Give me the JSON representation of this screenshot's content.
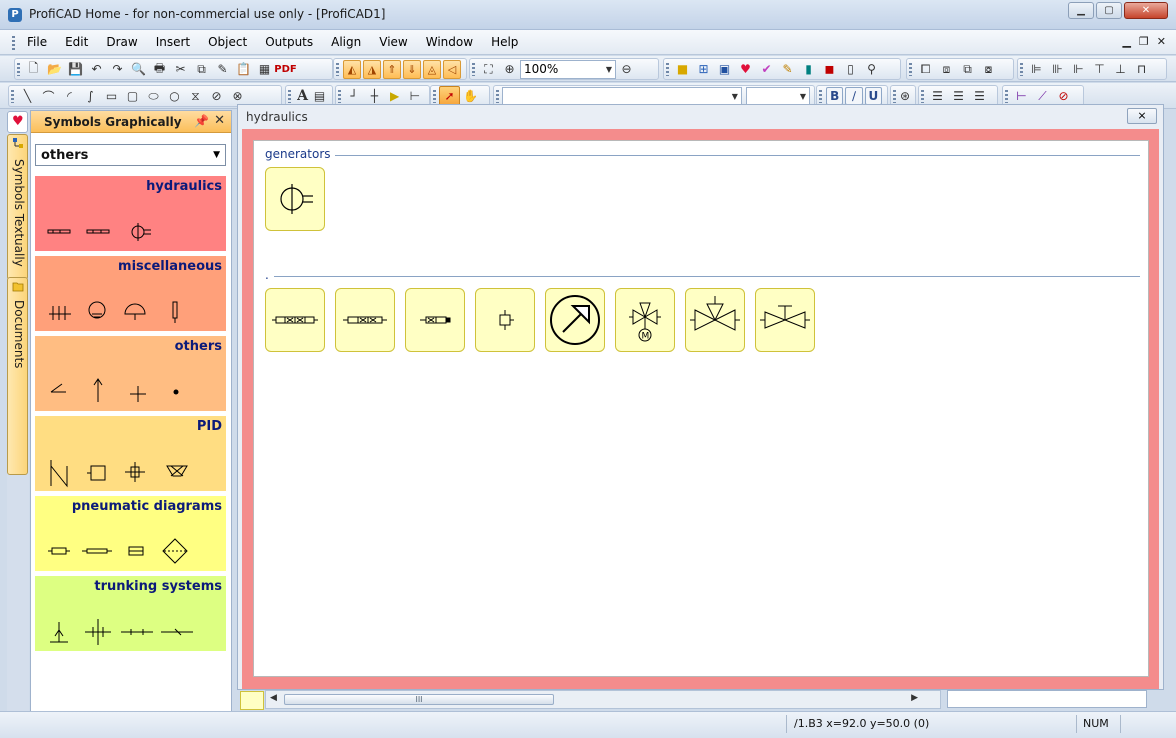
{
  "window": {
    "title": "ProfiCAD Home - for non-commercial use only - [ProfiCAD1]",
    "controls": [
      "minimize",
      "maximize",
      "close"
    ]
  },
  "menu": {
    "items": [
      "File",
      "Edit",
      "Draw",
      "Insert",
      "Object",
      "Outputs",
      "Align",
      "View",
      "Window",
      "Help"
    ]
  },
  "toolbar": {
    "zoom_value": "100%",
    "pdf_label": "PDF",
    "text_tool_label": "A",
    "bold_label": "B",
    "underline_label": "U",
    "font_name": "",
    "font_size": ""
  },
  "sidetabs": {
    "textual": "Symbols Textually",
    "documents": "Documents"
  },
  "panel": {
    "title": "Symbols Graphically",
    "pin_icon": "pin-icon",
    "close_label": "✕",
    "selected_category": "others",
    "categories": [
      {
        "name": "hydraulics",
        "color": "#ff8282"
      },
      {
        "name": "miscellaneous",
        "color": "#ffa07a"
      },
      {
        "name": "others",
        "color": "#ffbd82"
      },
      {
        "name": "PID",
        "color": "#ffdd82"
      },
      {
        "name": "pneumatic diagrams",
        "color": "#ffff82"
      },
      {
        "name": "trunking systems",
        "color": "#ddff82"
      }
    ]
  },
  "document": {
    "title": "hydraulics",
    "close_label": "⨯",
    "groups": [
      {
        "label": "generators",
        "tile_count": 1
      },
      {
        "label": ".",
        "tile_count": 8
      }
    ]
  },
  "scrollbar": {
    "thumb_grip": "III"
  },
  "status": {
    "coords": "/1.B3  x=92.0  y=50.0 (0)",
    "num": "NUM"
  }
}
